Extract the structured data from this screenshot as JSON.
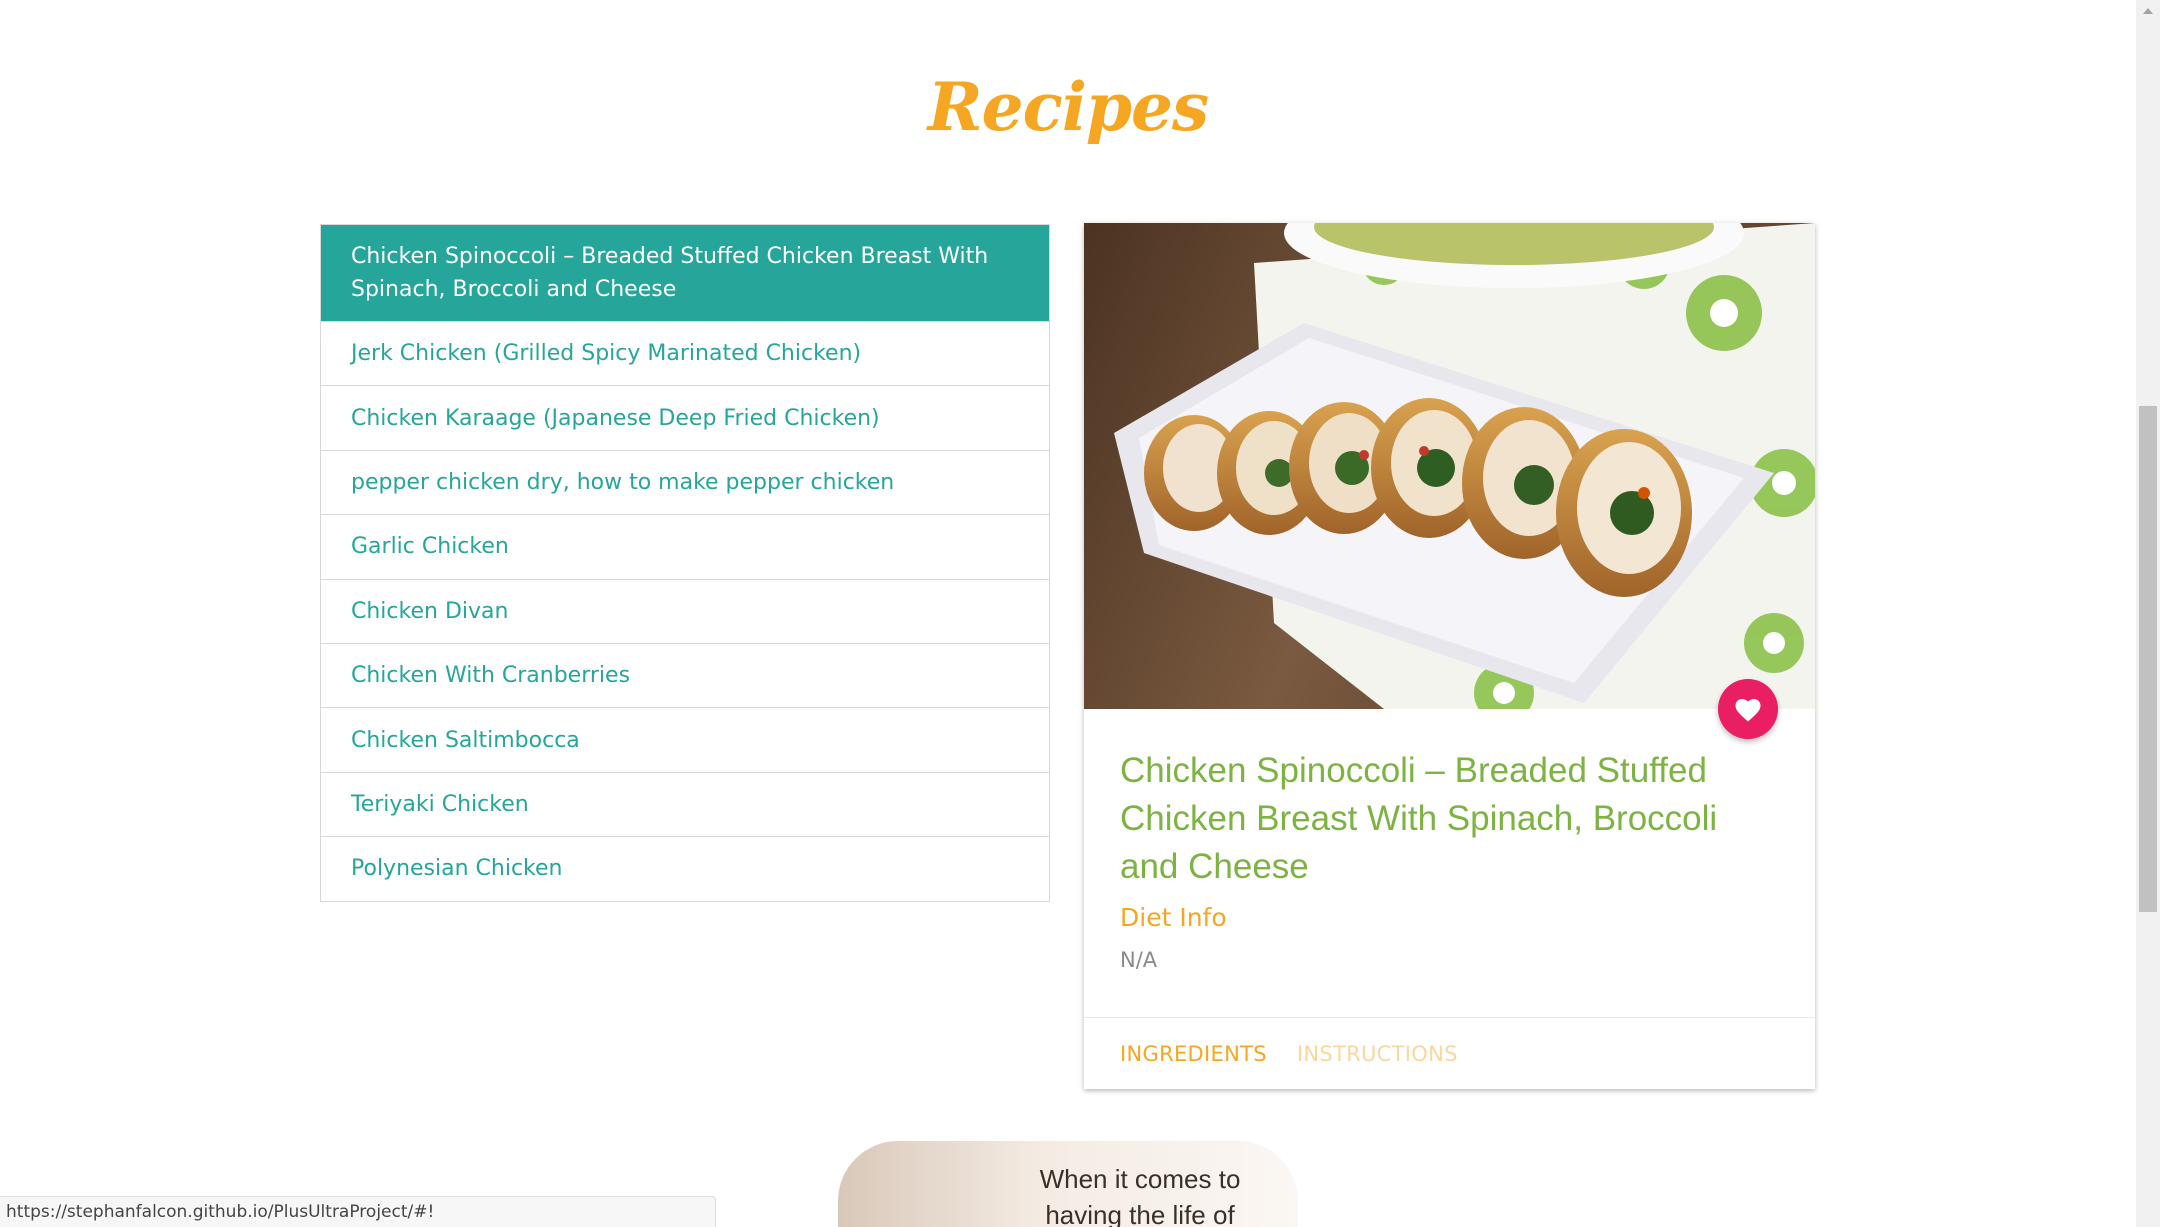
{
  "page": {
    "title": "Recipes"
  },
  "recipes": {
    "items": [
      {
        "label": "Chicken Spinoccoli – Breaded Stuffed Chicken Breast With Spinach, Broccoli and Cheese"
      },
      {
        "label": "Jerk Chicken (Grilled Spicy Marinated Chicken)"
      },
      {
        "label": "Chicken Karaage (Japanese Deep Fried Chicken)"
      },
      {
        "label": "pepper chicken dry, how to make pepper chicken"
      },
      {
        "label": "Garlic Chicken"
      },
      {
        "label": "Chicken Divan"
      },
      {
        "label": "Chicken With Cranberries"
      },
      {
        "label": "Chicken Saltimbocca"
      },
      {
        "label": "Teriyaki Chicken"
      },
      {
        "label": "Polynesian Chicken"
      }
    ],
    "selected_index": 0
  },
  "detail": {
    "title": "Chicken Spinoccoli – Breaded Stuffed Chicken Breast With Spinach, Broccoli and Cheese",
    "diet_label": "Diet Info",
    "diet_value": "N/A",
    "favorite_icon": "heart-icon",
    "tabs": [
      {
        "label": "INGREDIENTS",
        "active": true
      },
      {
        "label": "INSTRUCTIONS",
        "active": false
      }
    ]
  },
  "banner": {
    "line1": "When it comes to",
    "line2": "having the life of"
  },
  "status_bar": {
    "url": "https://stephanfalcon.github.io/PlusUltraProject/#!"
  },
  "colors": {
    "title": "#f5a623",
    "accent": "#26a69a",
    "card_title": "#7cb342",
    "favorite": "#e91e63"
  }
}
